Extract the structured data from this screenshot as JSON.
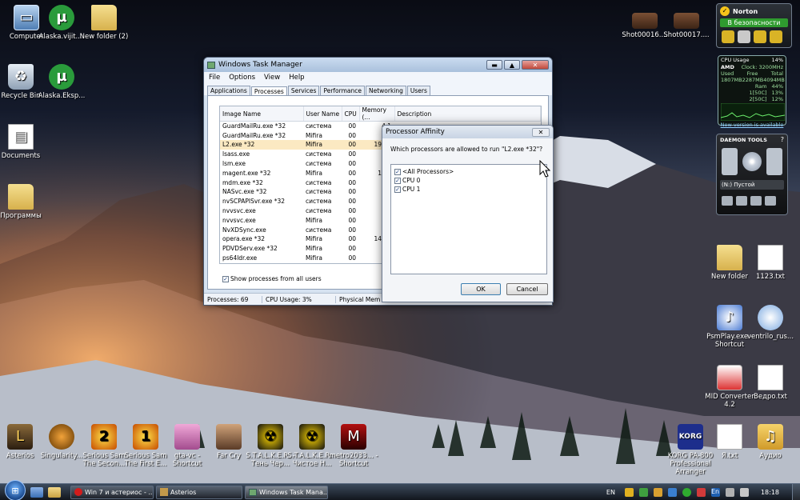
{
  "desktop": {
    "left_icons": [
      {
        "label": "Computer",
        "icon": "computer-icon"
      },
      {
        "label": "Alaska.vijit....",
        "icon": "utorrent-icon"
      },
      {
        "label": "New folder (2)",
        "icon": "folder-icon"
      },
      {
        "label": "Recycle Bin",
        "icon": "recycle-bin-icon"
      },
      {
        "label": "Alaska.Eksp...",
        "icon": "utorrent-icon"
      },
      {
        "label": "Documents",
        "icon": "documents-icon"
      },
      {
        "label": "Программы",
        "icon": "folder-icon"
      }
    ],
    "right_icons": [
      {
        "label": "Shot00016....",
        "icon": "screenshot-icon"
      },
      {
        "label": "Shot00017....",
        "icon": "screenshot-icon"
      },
      {
        "label": "New folder",
        "icon": "folder-icon"
      },
      {
        "label": "1123.txt",
        "icon": "text-file-icon"
      },
      {
        "label": "PsmPlay.exe - Shortcut",
        "icon": "psmplay-icon"
      },
      {
        "label": "ventrilo_rus...",
        "icon": "ventrilo-icon"
      },
      {
        "label": "MID Converter 4.2",
        "icon": "mid-converter-icon"
      },
      {
        "label": "Ведро.txt",
        "icon": "text-file-icon"
      },
      {
        "label": "KORG PA-800 Professional Arranger",
        "icon": "korg-icon"
      },
      {
        "label": "Я.txt",
        "icon": "text-file-icon"
      },
      {
        "label": "Аудио",
        "icon": "folder-icon"
      }
    ],
    "bottom_icons": [
      {
        "label": "Asterios",
        "icon": "asterios-icon"
      },
      {
        "label": "Singularity...",
        "icon": "singularity-icon"
      },
      {
        "label": "Serious Sam The Secon...",
        "icon": "serious-sam-icon"
      },
      {
        "label": "Serious Sam The First E...",
        "icon": "serious-sam-icon"
      },
      {
        "label": "gta-vc - Shortcut",
        "icon": "gta-icon"
      },
      {
        "label": "Far Cry",
        "icon": "farcry-icon"
      },
      {
        "label": "S.T.A.L.K.E.R. - Тень Чер...",
        "icon": "stalker-icon"
      },
      {
        "label": "S.T.A.L.K.E.R. - Чистое Н...",
        "icon": "stalker-icon"
      },
      {
        "label": "metro2033... - Shortcut",
        "icon": "metro-icon"
      }
    ]
  },
  "norton": {
    "brand": "Norton",
    "status": "В безопасности"
  },
  "cpu_gadget": {
    "title": "CPU Usage",
    "usage": "14%",
    "vendor": "AMD",
    "clock": "Clock: 3200MHz",
    "ram_headers": [
      "Used",
      "Free",
      "Total"
    ],
    "ram_values": [
      "1807MB",
      "2287MB",
      "4094MB"
    ],
    "ram_label": "Ram",
    "ram_percent": "44%",
    "cores": [
      {
        "label": "1[50C]",
        "value": "13%"
      },
      {
        "label": "2[50C]",
        "value": "12%"
      }
    ],
    "update_link": "New version is available"
  },
  "daemon": {
    "brand": "DAEMON TOOLS",
    "help": "?",
    "drive": "(N:) Пустой"
  },
  "task_manager": {
    "title": "Windows Task Manager",
    "menu": [
      "File",
      "Options",
      "View",
      "Help"
    ],
    "tabs": [
      "Applications",
      "Processes",
      "Services",
      "Performance",
      "Networking",
      "Users"
    ],
    "active_tab": 1,
    "columns": [
      "Image Name",
      "User Name",
      "CPU",
      "Memory (...",
      "Description"
    ],
    "rows": [
      {
        "image": "GuardMailRu.exe *32",
        "user": "система",
        "cpu": "00",
        "mem": "4 1"
      },
      {
        "image": "GuardMailRu.exe *32",
        "user": "Mifira",
        "cpu": "00",
        "mem": "4 2"
      },
      {
        "image": "L2.exe *32",
        "user": "Mifira",
        "cpu": "00",
        "mem": "193 8"
      },
      {
        "image": "lsass.exe",
        "user": "система",
        "cpu": "00",
        "mem": "3 6"
      },
      {
        "image": "lsm.exe",
        "user": "система",
        "cpu": "00",
        "mem": "1 5"
      },
      {
        "image": "magent.exe *32",
        "user": "Mifira",
        "cpu": "00",
        "mem": "16 7"
      },
      {
        "image": "mdm.exe *32",
        "user": "система",
        "cpu": "00",
        "mem": "1 0"
      },
      {
        "image": "NASvc.exe *32",
        "user": "система",
        "cpu": "00",
        "mem": "1 7"
      },
      {
        "image": "nvSCPAPISvr.exe *32",
        "user": "система",
        "cpu": "00",
        "mem": "2 6"
      },
      {
        "image": "nvvsvc.exe",
        "user": "система",
        "cpu": "00",
        "mem": "2 1"
      },
      {
        "image": "nvvsvc.exe",
        "user": "Mifira",
        "cpu": "00",
        "mem": "3 5"
      },
      {
        "image": "NvXDSync.exe",
        "user": "система",
        "cpu": "00",
        "mem": "2 5"
      },
      {
        "image": "opera.exe *32",
        "user": "Mifira",
        "cpu": "00",
        "mem": "149 4"
      },
      {
        "image": "PDVDServ.exe *32",
        "user": "Mifira",
        "cpu": "00",
        "mem": "1 0"
      },
      {
        "image": "ps64ldr.exe",
        "user": "Mifira",
        "cpu": "00",
        "mem": "8"
      }
    ],
    "selected_row": 2,
    "show_all_label": "Show processes from all users",
    "status": {
      "processes": "Processes: 69",
      "cpu": "CPU Usage: 3%",
      "memory": "Physical Mem"
    }
  },
  "affinity": {
    "title": "Processor Affinity",
    "question": "Which processors are allowed to run \"L2.exe *32\"?",
    "options": [
      "<All Processors>",
      "CPU 0",
      "CPU 1"
    ],
    "ok": "OK",
    "cancel": "Cancel"
  },
  "taskbar": {
    "items": [
      {
        "label": "Win 7 и астериос - ...",
        "icon": "opera-icon"
      },
      {
        "label": "Asterios",
        "icon": "asterios-icon"
      },
      {
        "label": "Windows Task Mana...",
        "icon": "task-manager-icon"
      }
    ],
    "active_item": 2,
    "language": "EN",
    "tray_lang": "En",
    "clock": "18:18"
  }
}
